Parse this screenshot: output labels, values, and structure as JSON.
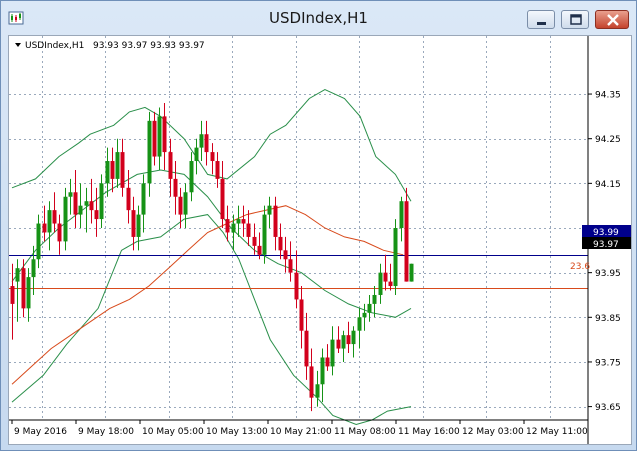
{
  "window": {
    "title": "USDIndex,H1"
  },
  "chart_data": {
    "type": "candlestick",
    "symbol_label": "USDIndex,H1",
    "ohlc_label": "93.93 93.97 93.93 93.97",
    "ylim": [
      93.62,
      94.48
    ],
    "y_ticks": [
      "94.35",
      "94.25",
      "94.15",
      "94.05",
      "93.95",
      "93.85",
      "93.75",
      "93.65"
    ],
    "x_ticks": [
      "9 May 2016",
      "9 May 18:00",
      "10 May 05:00",
      "10 May 13:00",
      "10 May 21:00",
      "11 May 08:00",
      "11 May 16:00",
      "12 May 03:00",
      "12 May 11:00"
    ],
    "price_line": {
      "value": 93.99,
      "label": "93.99"
    },
    "bid_line": {
      "value": 93.97,
      "label": "93.97"
    },
    "fib_level": {
      "value": 93.915,
      "label": "23.6"
    },
    "candles": [
      [
        93.92,
        93.97,
        93.8,
        93.88
      ],
      [
        93.93,
        93.98,
        93.84,
        93.96
      ],
      [
        93.96,
        93.98,
        93.85,
        93.87
      ],
      [
        93.87,
        93.96,
        93.84,
        93.94
      ],
      [
        93.94,
        94.01,
        93.9,
        93.98
      ],
      [
        93.98,
        94.08,
        93.96,
        94.06
      ],
      [
        94.06,
        94.1,
        94.02,
        94.04
      ],
      [
        94.04,
        94.11,
        94.0,
        94.09
      ],
      [
        94.09,
        94.13,
        94.04,
        94.06
      ],
      [
        94.06,
        94.08,
        93.99,
        94.02
      ],
      [
        94.02,
        94.14,
        94.0,
        94.12
      ],
      [
        94.12,
        94.16,
        94.08,
        94.13
      ],
      [
        94.13,
        94.18,
        94.05,
        94.08
      ],
      [
        94.08,
        94.15,
        94.05,
        94.1
      ],
      [
        94.1,
        94.14,
        94.04,
        94.11
      ],
      [
        94.11,
        94.16,
        94.06,
        94.09
      ],
      [
        94.09,
        94.14,
        94.03,
        94.07
      ],
      [
        94.07,
        94.17,
        94.05,
        94.15
      ],
      [
        94.15,
        94.23,
        94.12,
        94.2
      ],
      [
        94.2,
        94.23,
        94.13,
        94.16
      ],
      [
        94.16,
        94.25,
        94.14,
        94.22
      ],
      [
        94.22,
        94.25,
        94.12,
        94.14
      ],
      [
        94.14,
        94.18,
        94.06,
        94.09
      ],
      [
        94.09,
        94.12,
        94.0,
        94.03
      ],
      [
        94.03,
        94.1,
        94.0,
        94.08
      ],
      [
        94.08,
        94.17,
        94.04,
        94.15
      ],
      [
        94.15,
        94.31,
        94.12,
        94.29
      ],
      [
        94.29,
        94.31,
        94.19,
        94.21
      ],
      [
        94.21,
        94.32,
        94.18,
        94.3
      ],
      [
        94.3,
        94.33,
        94.18,
        94.22
      ],
      [
        94.22,
        94.25,
        94.12,
        94.16
      ],
      [
        94.16,
        94.2,
        94.08,
        94.12
      ],
      [
        94.12,
        94.14,
        94.05,
        94.08
      ],
      [
        94.08,
        94.15,
        94.05,
        94.13
      ],
      [
        94.13,
        94.22,
        94.11,
        94.2
      ],
      [
        94.2,
        94.25,
        94.17,
        94.23
      ],
      [
        94.23,
        94.29,
        94.2,
        94.26
      ],
      [
        94.26,
        94.29,
        94.19,
        94.22
      ],
      [
        94.22,
        94.24,
        94.17,
        94.2
      ],
      [
        94.2,
        94.22,
        94.14,
        94.16
      ],
      [
        94.16,
        94.2,
        94.05,
        94.07
      ],
      [
        94.07,
        94.1,
        94.02,
        94.04
      ],
      [
        94.04,
        94.08,
        94.0,
        94.06
      ],
      [
        94.06,
        94.1,
        94.03,
        94.07
      ],
      [
        94.07,
        94.1,
        94.03,
        94.06
      ],
      [
        94.06,
        94.09,
        94.01,
        94.03
      ],
      [
        94.03,
        94.06,
        93.99,
        94.01
      ],
      [
        94.01,
        94.04,
        93.98,
        93.99
      ],
      [
        93.99,
        94.1,
        93.97,
        94.08
      ],
      [
        94.08,
        94.12,
        94.05,
        94.1
      ],
      [
        94.1,
        94.12,
        94.0,
        94.03
      ],
      [
        94.03,
        94.06,
        93.98,
        94.0
      ],
      [
        94.0,
        94.03,
        93.95,
        93.98
      ],
      [
        93.98,
        94.02,
        93.93,
        93.95
      ],
      [
        93.95,
        94.0,
        93.87,
        93.89
      ],
      [
        93.89,
        93.92,
        93.78,
        93.82
      ],
      [
        93.82,
        93.86,
        93.71,
        93.74
      ],
      [
        93.74,
        93.78,
        93.64,
        93.67
      ],
      [
        93.67,
        93.73,
        93.65,
        93.7
      ],
      [
        93.7,
        93.78,
        93.66,
        93.76
      ],
      [
        93.76,
        93.79,
        93.73,
        93.74
      ],
      [
        93.74,
        93.83,
        93.72,
        93.8
      ],
      [
        93.8,
        93.83,
        93.77,
        93.78
      ],
      [
        93.78,
        93.82,
        93.75,
        93.81
      ],
      [
        93.81,
        93.84,
        93.77,
        93.79
      ],
      [
        93.79,
        93.83,
        93.76,
        93.82
      ],
      [
        93.82,
        93.87,
        93.78,
        93.85
      ],
      [
        93.85,
        93.88,
        93.82,
        93.86
      ],
      [
        93.86,
        93.9,
        93.84,
        93.88
      ],
      [
        93.88,
        93.92,
        93.85,
        93.9
      ],
      [
        93.9,
        93.97,
        93.88,
        93.95
      ],
      [
        93.95,
        93.99,
        93.91,
        93.93
      ],
      [
        93.93,
        93.97,
        93.91,
        93.92
      ],
      [
        93.92,
        94.07,
        93.9,
        94.05
      ],
      [
        94.05,
        94.12,
        94.02,
        94.11
      ],
      [
        94.11,
        94.14,
        93.93,
        93.93
      ],
      [
        93.93,
        93.97,
        93.93,
        93.97
      ]
    ],
    "ma_slow": [
      [
        0,
        93.7
      ],
      [
        5,
        93.74
      ],
      [
        10,
        93.78
      ],
      [
        15,
        93.81
      ],
      [
        20,
        93.84
      ],
      [
        25,
        93.87
      ],
      [
        30,
        93.89
      ],
      [
        35,
        93.92
      ],
      [
        40,
        93.96
      ],
      [
        45,
        94.0
      ],
      [
        50,
        94.04
      ],
      [
        55,
        94.06
      ],
      [
        60,
        94.08
      ],
      [
        65,
        94.09
      ],
      [
        70,
        94.1
      ],
      [
        75,
        94.08
      ],
      [
        80,
        94.05
      ],
      [
        85,
        94.03
      ],
      [
        90,
        94.02
      ],
      [
        95,
        94.0
      ],
      [
        100,
        93.99
      ]
    ],
    "bollinger_upper": [
      [
        0,
        94.14
      ],
      [
        6,
        94.16
      ],
      [
        12,
        94.21
      ],
      [
        17,
        94.24
      ],
      [
        20,
        94.26
      ],
      [
        26,
        94.28
      ],
      [
        30,
        94.31
      ],
      [
        34,
        94.32
      ],
      [
        38,
        94.3
      ],
      [
        44,
        94.25
      ],
      [
        50,
        94.17
      ],
      [
        55,
        94.16
      ],
      [
        62,
        94.21
      ],
      [
        66,
        94.26
      ],
      [
        70,
        94.28
      ],
      [
        76,
        94.34
      ],
      [
        80,
        94.36
      ],
      [
        85,
        94.34
      ],
      [
        89,
        94.3
      ],
      [
        93,
        94.21
      ],
      [
        98,
        94.17
      ],
      [
        102,
        94.11
      ]
    ],
    "bollinger_mid": [
      [
        0,
        93.93
      ],
      [
        6,
        94.0
      ],
      [
        12,
        94.05
      ],
      [
        18,
        94.09
      ],
      [
        24,
        94.13
      ],
      [
        28,
        94.15
      ],
      [
        32,
        94.17
      ],
      [
        38,
        94.18
      ],
      [
        44,
        94.17
      ],
      [
        50,
        94.12
      ],
      [
        56,
        94.05
      ],
      [
        62,
        94.0
      ],
      [
        68,
        93.97
      ],
      [
        74,
        93.95
      ],
      [
        80,
        93.91
      ],
      [
        86,
        93.88
      ],
      [
        92,
        93.86
      ],
      [
        98,
        93.85
      ],
      [
        102,
        93.87
      ]
    ],
    "bollinger_lower": [
      [
        0,
        93.66
      ],
      [
        8,
        93.72
      ],
      [
        14,
        93.79
      ],
      [
        22,
        93.87
      ],
      [
        28,
        94.0
      ],
      [
        32,
        94.02
      ],
      [
        38,
        94.03
      ],
      [
        44,
        94.07
      ],
      [
        50,
        94.08
      ],
      [
        54,
        94.04
      ],
      [
        58,
        93.98
      ],
      [
        62,
        93.89
      ],
      [
        66,
        93.8
      ],
      [
        72,
        93.72
      ],
      [
        78,
        93.67
      ],
      [
        82,
        93.63
      ],
      [
        88,
        93.61
      ],
      [
        92,
        93.62
      ],
      [
        96,
        93.64
      ],
      [
        102,
        93.65
      ]
    ],
    "colors": {
      "bull": "#169216",
      "bear": "#d2001c",
      "ma": "#d84a1b",
      "band": "#2a8f4a",
      "price_line": "#00008b",
      "grid": "#9aa9bc"
    }
  }
}
